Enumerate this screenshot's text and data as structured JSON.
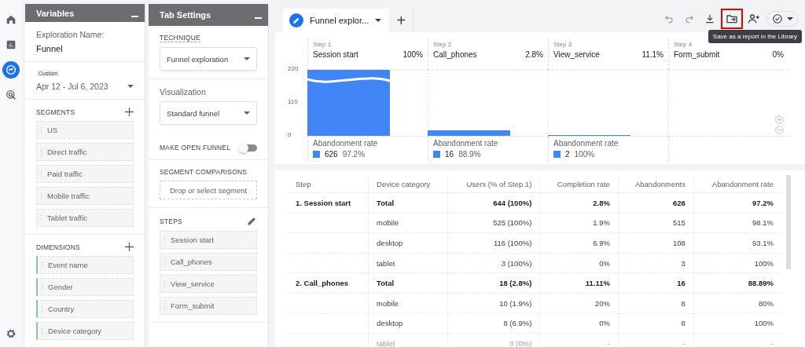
{
  "rail": {
    "items": [
      {
        "selected": false
      },
      {
        "selected": false
      },
      {
        "selected": true
      },
      {
        "selected": false
      }
    ]
  },
  "variables": {
    "title": "Variables",
    "exploration_label": "Exploration Name:",
    "exploration_name": "Funnel",
    "date_tag": "Custom",
    "date_range": "Apr 12 - Jul 6, 2023",
    "segments": {
      "heading": "SEGMENTS",
      "items": [
        "US",
        "Direct traffic",
        "Paid traffic",
        "Mobile traffic",
        "Tablet traffic"
      ]
    },
    "dimensions": {
      "heading": "DIMENSIONS",
      "items": [
        "Event name",
        "Gender",
        "Country",
        "Device category"
      ]
    }
  },
  "tab_settings": {
    "title": "Tab Settings",
    "technique_label": "TECHNIQUE",
    "technique": "Funnel exploration",
    "visualization_label": "Visualization",
    "visualization": "Standard funnel",
    "open_funnel_label": "MAKE OPEN FUNNEL",
    "open_funnel_on": false,
    "segment_comparisons_label": "SEGMENT COMPARISONS",
    "segment_drop": "Drop or select segment",
    "steps_label": "STEPS",
    "steps": [
      "Session start",
      "Call_phones",
      "View_service",
      "Form_submit"
    ]
  },
  "tab": {
    "label": "Funnel explor...",
    "add": "+"
  },
  "toolbar": [
    {
      "highlighted": false
    },
    {
      "highlighted": false
    },
    {
      "highlighted": false
    },
    {
      "highlighted": true
    },
    {
      "highlighted": false
    },
    {
      "highlighted": false
    }
  ],
  "tooltip": "Save as a report in the Library",
  "funnel": {
    "steps": [
      {
        "step": "Step 1",
        "name": "Session start",
        "percent": "100%",
        "abandonment_label": "Abandonment rate",
        "abandonment_count": "626",
        "abandonment_rate": "97.2%"
      },
      {
        "step": "Step 2",
        "name": "Call_phones",
        "percent": "2.8%",
        "abandonment_label": "Abandonment rate",
        "abandonment_count": "16",
        "abandonment_rate": "88.9%"
      },
      {
        "step": "Step 3",
        "name": "View_service",
        "percent": "11.1%",
        "abandonment_label": "Abandonment rate",
        "abandonment_count": "2",
        "abandonment_rate": "100%"
      },
      {
        "step": "Step 4",
        "name": "Form_submit",
        "percent": "0%"
      }
    ],
    "axis_labels": [
      "220",
      "110",
      "0"
    ]
  },
  "table": {
    "columns": [
      "Step",
      "Device category",
      "Users (% of Step 1)",
      "Completion rate",
      "Abandonments",
      "Abandonment rate"
    ],
    "rows": [
      {
        "kind": "total",
        "faded": false,
        "cells": [
          "1. Session start",
          "Total",
          "644 (100%)",
          "2.8%",
          "626",
          "97.2%"
        ]
      },
      {
        "kind": "device",
        "faded": false,
        "cells": [
          "",
          "mobile",
          "525 (100%)",
          "1.9%",
          "515",
          "98.1%"
        ]
      },
      {
        "kind": "device",
        "faded": false,
        "cells": [
          "",
          "desktop",
          "116 (100%)",
          "6.9%",
          "108",
          "93.1%"
        ]
      },
      {
        "kind": "device",
        "faded": false,
        "cells": [
          "",
          "tablet",
          "3 (100%)",
          "0%",
          "3",
          "100%"
        ]
      },
      {
        "kind": "total",
        "faded": false,
        "cells": [
          "2. Call_phones",
          "Total",
          "18 (2.8%)",
          "11.11%",
          "16",
          "88.89%"
        ]
      },
      {
        "kind": "device",
        "faded": false,
        "cells": [
          "",
          "mobile",
          "10 (1.9%)",
          "20%",
          "8",
          "80%"
        ]
      },
      {
        "kind": "device",
        "faded": false,
        "cells": [
          "",
          "desktop",
          "8 (6.9%)",
          "0%",
          "8",
          "100%"
        ]
      },
      {
        "kind": "device",
        "faded": true,
        "cells": [
          "",
          "tablet",
          "0 (0%)",
          "-",
          "-",
          "-"
        ]
      }
    ]
  }
}
